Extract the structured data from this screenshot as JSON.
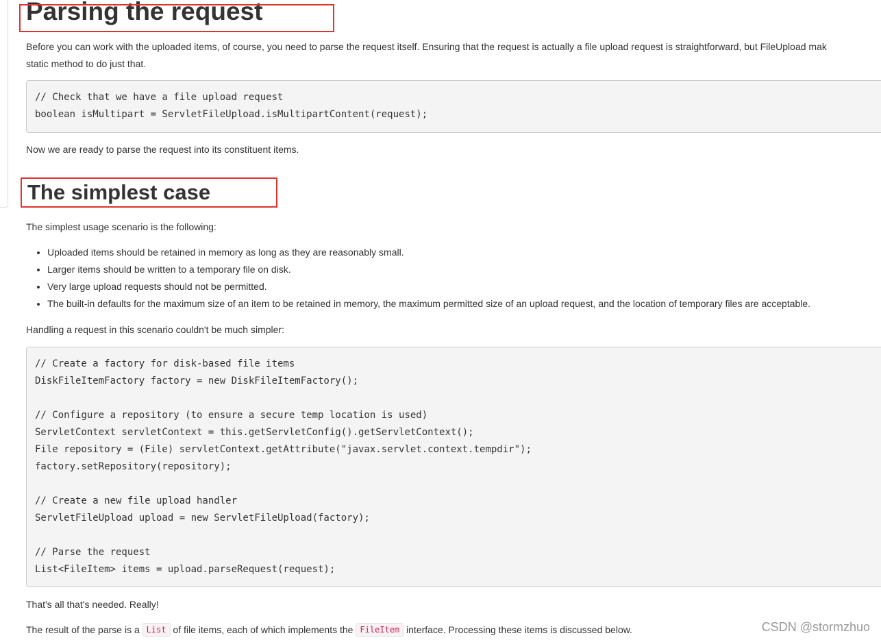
{
  "sections": [
    {
      "heading": "Parsing the request",
      "intro_line1": "Before you can work with the uploaded items, of course, you need to parse the request itself. Ensuring that the request is actually a file upload request is straightforward, but FileUpload mak",
      "intro_line2": "static method to do just that.",
      "code": "// Check that we have a file upload request\nboolean isMultipart = ServletFileUpload.isMultipartContent(request);",
      "after": "Now we are ready to parse the request into its constituent items."
    },
    {
      "heading": "The simplest case",
      "intro": "The simplest usage scenario is the following:",
      "bullets": [
        "Uploaded items should be retained in memory as long as they are reasonably small.",
        "Larger items should be written to a temporary file on disk.",
        "Very large upload requests should not be permitted.",
        "The built-in defaults for the maximum size of an item to be retained in memory, the maximum permitted size of an upload request, and the location of temporary files are acceptable."
      ],
      "lead": "Handling a request in this scenario couldn't be much simpler:",
      "code": "// Create a factory for disk-based file items\nDiskFileItemFactory factory = new DiskFileItemFactory();\n\n// Configure a repository (to ensure a secure temp location is used)\nServletContext servletContext = this.getServletConfig().getServletContext();\nFile repository = (File) servletContext.getAttribute(\"javax.servlet.context.tempdir\");\nfactory.setRepository(repository);\n\n// Create a new file upload handler\nServletFileUpload upload = new ServletFileUpload(factory);\n\n// Parse the request\nList<FileItem> items = upload.parseRequest(request);",
      "conclusion": "That's all that's needed. Really!",
      "result": {
        "before": "The result of the parse is a ",
        "code1": "List",
        "middle": " of file items, each of which implements the ",
        "code2": "FileItem",
        "after": " interface. Processing these items is discussed below."
      }
    }
  ],
  "annotation_color": "#e0332e",
  "watermark": "CSDN @stormzhuo"
}
